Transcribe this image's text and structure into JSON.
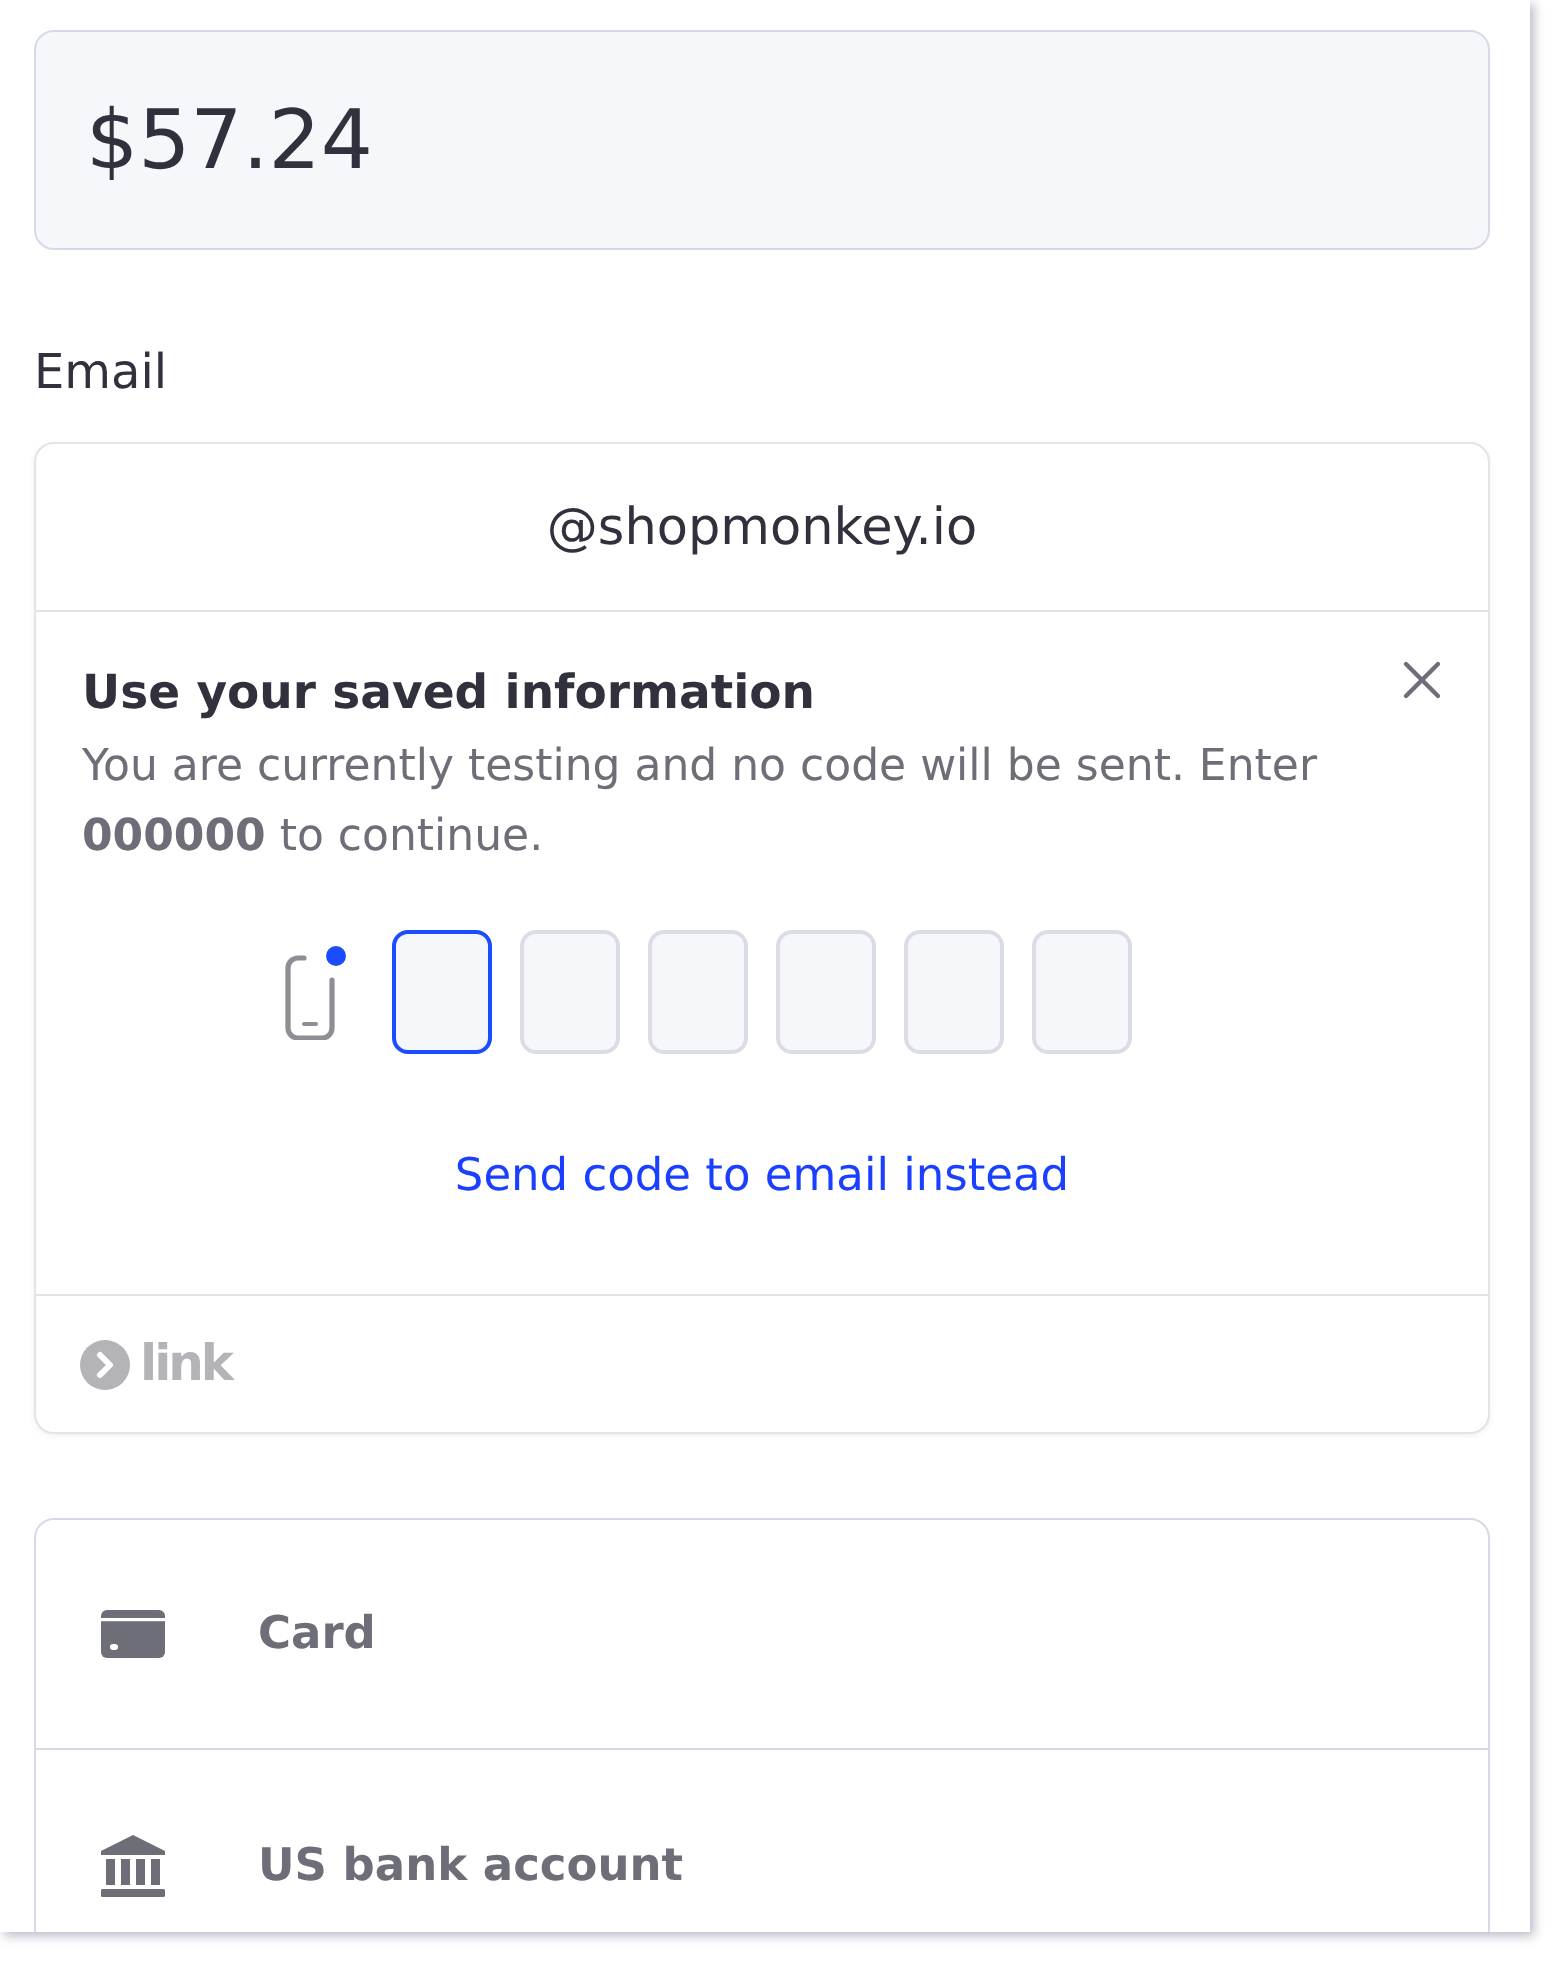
{
  "amount": "$57.24",
  "email": {
    "label": "Email",
    "value": "@shopmonkey.io"
  },
  "saved_info": {
    "title": "Use your saved information",
    "message": "You are currently testing and no code will be sent. Enter **000000** to continue.",
    "code_boxes": [
      {
        "focused": true
      },
      {
        "focused": false
      },
      {
        "focused": false
      },
      {
        "focused": false
      },
      {
        "focused": false
      },
      {
        "focused": false
      }
    ],
    "alternate_link": "Send code to email instead",
    "brand": "link"
  },
  "payment_methods": [
    {
      "kind": "card",
      "label": "Card"
    },
    {
      "kind": "bank",
      "label": "US bank account"
    }
  ]
}
